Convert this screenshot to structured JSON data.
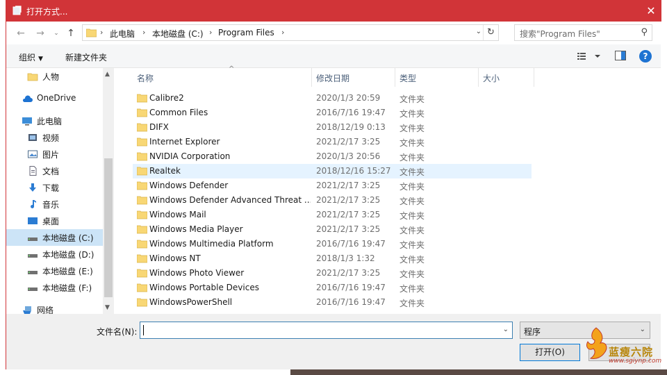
{
  "window": {
    "title": "打开方式...",
    "close_glyph": "✕"
  },
  "nav": {
    "back_glyph": "←",
    "forward_glyph": "→",
    "up_glyph": "↑",
    "breadcrumb": [
      "此电脑",
      "本地磁盘 (C:)",
      "Program Files"
    ],
    "search_placeholder": "搜索\"Program Files\""
  },
  "toolbar": {
    "organize": "组织",
    "new_folder": "新建文件夹"
  },
  "sidebar": {
    "items": [
      {
        "label": "人物",
        "icon": "folder-icon"
      },
      {
        "label": "OneDrive",
        "icon": "cloud-icon"
      },
      {
        "label": "此电脑",
        "icon": "computer-icon"
      },
      {
        "label": "视频",
        "icon": "video-icon"
      },
      {
        "label": "图片",
        "icon": "picture-icon"
      },
      {
        "label": "文档",
        "icon": "document-icon"
      },
      {
        "label": "下载",
        "icon": "download-icon"
      },
      {
        "label": "音乐",
        "icon": "music-icon"
      },
      {
        "label": "桌面",
        "icon": "desktop-icon"
      },
      {
        "label": "本地磁盘 (C:)",
        "icon": "drive-icon",
        "selected": true
      },
      {
        "label": "本地磁盘 (D:)",
        "icon": "drive-icon"
      },
      {
        "label": "本地磁盘 (E:)",
        "icon": "drive-icon"
      },
      {
        "label": "本地磁盘 (F:)",
        "icon": "drive-icon"
      },
      {
        "label": "网络",
        "icon": "network-icon"
      }
    ]
  },
  "columns": {
    "name": "名称",
    "modified": "修改日期",
    "type": "类型",
    "size": "大小"
  },
  "files": [
    {
      "name": "Calibre2",
      "date": "2020/1/3 20:59",
      "type": "文件夹"
    },
    {
      "name": "Common Files",
      "date": "2016/7/16 19:47",
      "type": "文件夹"
    },
    {
      "name": "DIFX",
      "date": "2018/12/19 0:13",
      "type": "文件夹"
    },
    {
      "name": "Internet Explorer",
      "date": "2021/2/17 3:25",
      "type": "文件夹"
    },
    {
      "name": "NVIDIA Corporation",
      "date": "2020/1/3 20:56",
      "type": "文件夹"
    },
    {
      "name": "Realtek",
      "date": "2018/12/16 15:27",
      "type": "文件夹",
      "hover": true
    },
    {
      "name": "Windows Defender",
      "date": "2021/2/17 3:25",
      "type": "文件夹"
    },
    {
      "name": "Windows Defender Advanced Threat ...",
      "date": "2021/2/17 3:25",
      "type": "文件夹"
    },
    {
      "name": "Windows Mail",
      "date": "2021/2/17 3:25",
      "type": "文件夹"
    },
    {
      "name": "Windows Media Player",
      "date": "2021/2/17 3:25",
      "type": "文件夹"
    },
    {
      "name": "Windows Multimedia Platform",
      "date": "2016/7/16 19:47",
      "type": "文件夹"
    },
    {
      "name": "Windows NT",
      "date": "2018/1/3 1:32",
      "type": "文件夹"
    },
    {
      "name": "Windows Photo Viewer",
      "date": "2021/2/17 3:25",
      "type": "文件夹"
    },
    {
      "name": "Windows Portable Devices",
      "date": "2016/7/16 19:47",
      "type": "文件夹"
    },
    {
      "name": "WindowsPowerShell",
      "date": "2016/7/16 19:47",
      "type": "文件夹"
    }
  ],
  "footer": {
    "filename_label": "文件名(N):",
    "filename_value": "",
    "file_type": "程序",
    "open_button": "打开(O)"
  },
  "watermark": {
    "text": "蓝瘦六院",
    "url": "www.sgiynp.com"
  },
  "colors": {
    "titlebar": "#d13438",
    "selection": "#cce4f7",
    "hover": "#e5f3ff",
    "folder": "#f8d775",
    "accent": "#0078d7"
  }
}
